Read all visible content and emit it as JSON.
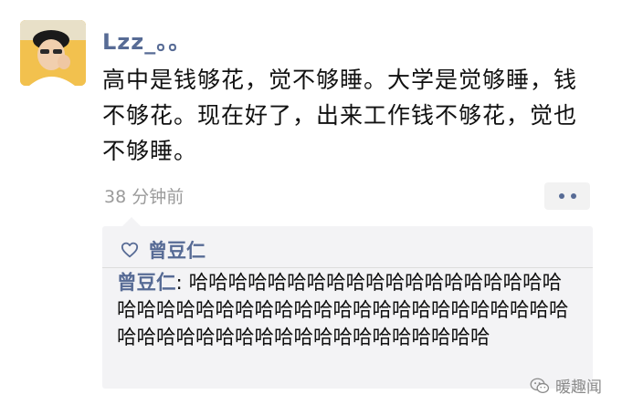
{
  "post": {
    "username": "Lzz_。。",
    "text": "高中是钱够花，觉不够睡。大学是觉够睡，钱不够花。现在好了，出来工作钱不够花，觉也不够睡。",
    "timestamp": "38 分钟前",
    "more_icon": "more-dots-icon"
  },
  "likes": {
    "icon": "heart-icon",
    "names": [
      "曾豆仁"
    ]
  },
  "comments": [
    {
      "author": "曾豆仁",
      "separator": ": ",
      "text": "哈哈哈哈哈哈哈哈哈哈哈哈哈哈哈哈哈哈哈哈哈哈哈哈哈哈哈哈哈哈哈哈哈哈哈哈哈哈哈哈哈哈哈哈哈哈哈哈哈哈哈哈哈哈哈哈哈哈哈哈哈"
    }
  ],
  "watermark": {
    "icon": "wechat-logo-icon",
    "text": "暖趣闻"
  },
  "colors": {
    "link_blue": "#576b95",
    "comment_bg": "#f3f3f5"
  }
}
